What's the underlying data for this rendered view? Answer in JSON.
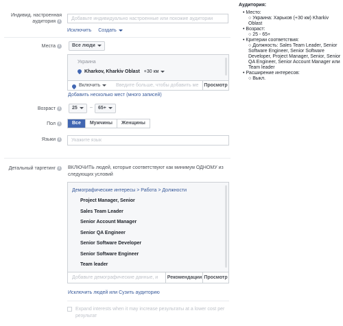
{
  "custom_audiences": {
    "label": "Индивид. настроенная аудитория",
    "placeholder": "Добавьте индивидуально настроенные или похожие аудитории",
    "exclude": "Исключить",
    "create": "Создать"
  },
  "places": {
    "label": "Места",
    "dropdown": "Все люди",
    "country": "Украина",
    "city": "Kharkov, Kharkiv Oblast",
    "radius": "+30 км",
    "include": "Включить",
    "search_placeholder": "Введите больше, чтобы добавить ме",
    "browse": "Просмотр",
    "bulk": "Добавить несколько мест (много записей)"
  },
  "age": {
    "label": "Возраст",
    "from": "25",
    "to": "65+",
    "dash": "–"
  },
  "gender": {
    "label": "Пол",
    "all": "Все",
    "men": "Мужчины",
    "women": "Женщины"
  },
  "languages": {
    "label": "Языки",
    "placeholder": "Укажите язык"
  },
  "detailed": {
    "label": "Детальный таргетинг",
    "description": "ВКЛЮЧИТЬ людей, которые соответствуют как минимум ОДНОМУ из следующих условий",
    "breadcrumb": "Демографические интересы > Работа > Должности",
    "items": [
      "Project Manager, Senior",
      "Sales Team Leader",
      "Senior Account Manager",
      "Senior QA Engineer",
      "Senior Software Developer",
      "Senior Software Engineer",
      "Team leader"
    ],
    "input_placeholder": "Добавьте демографические данные, и",
    "recommendations": "Рекомендации",
    "browse": "Просмотр",
    "footer_link": "Исключить людей или Сузить аудиторию",
    "expand_text": "Expand interests when it may increase результаты at a lower cost per результат"
  },
  "summary": {
    "title": "Аудитория:",
    "place_h": "Место:",
    "place_v": "Украина: Харьков (+30 км) Kharkiv Oblast",
    "age_h": "Возраст:",
    "age_v": "25 - 65+",
    "criteria_h": "Критерии соответствия:",
    "criteria_v": "Должность: Sales Team Leader, Senior Software Engineer, Senior Software Developer, Project Manager, Senior, Senior QA Engineer, Senior Account Manager или Team leader",
    "expand_h": "Расширение интересов:",
    "expand_v": "Выкл."
  }
}
